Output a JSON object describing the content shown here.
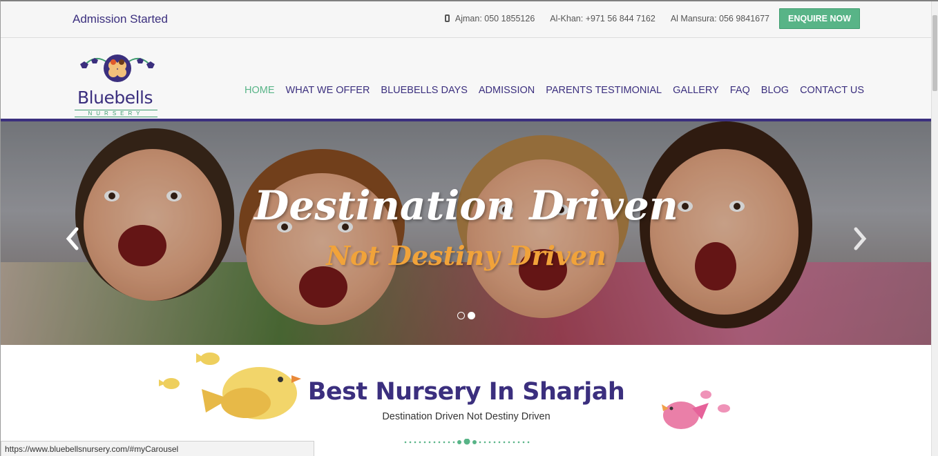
{
  "topbar": {
    "admission_text": "Admission Started",
    "phones": [
      "Ajman: 050 1855126",
      "Al-Khan: +971 56 844 7162",
      "Al Mansura: 056 9841677"
    ],
    "enquire_label": "ENQUIRE NOW"
  },
  "logo": {
    "name": "Bluebells",
    "sub": "NURSERY"
  },
  "nav": {
    "items": [
      "HOME",
      "WHAT WE OFFER",
      "BLUEBELLS DAYS",
      "ADMISSION",
      "PARENTS TESTIMONIAL",
      "GALLERY",
      "FAQ",
      "BLOG",
      "CONTACT US"
    ],
    "active": "HOME"
  },
  "hero": {
    "title": "Destination Driven",
    "subtitle": "Not Destiny Driven",
    "slide_count": 2,
    "active_slide": 2
  },
  "section": {
    "title": "Best Nursery In Sharjah",
    "subtitle": "Destination Driven Not Destiny Driven"
  },
  "statusbar": {
    "url": "https://www.bluebellsnursery.com/#myCarousel"
  },
  "colors": {
    "brand_purple": "#3b2f7e",
    "brand_green": "#58b487",
    "accent_orange": "#f1a33a"
  },
  "icons": [
    "phone-icon",
    "chevron-left-icon",
    "chevron-right-icon"
  ]
}
